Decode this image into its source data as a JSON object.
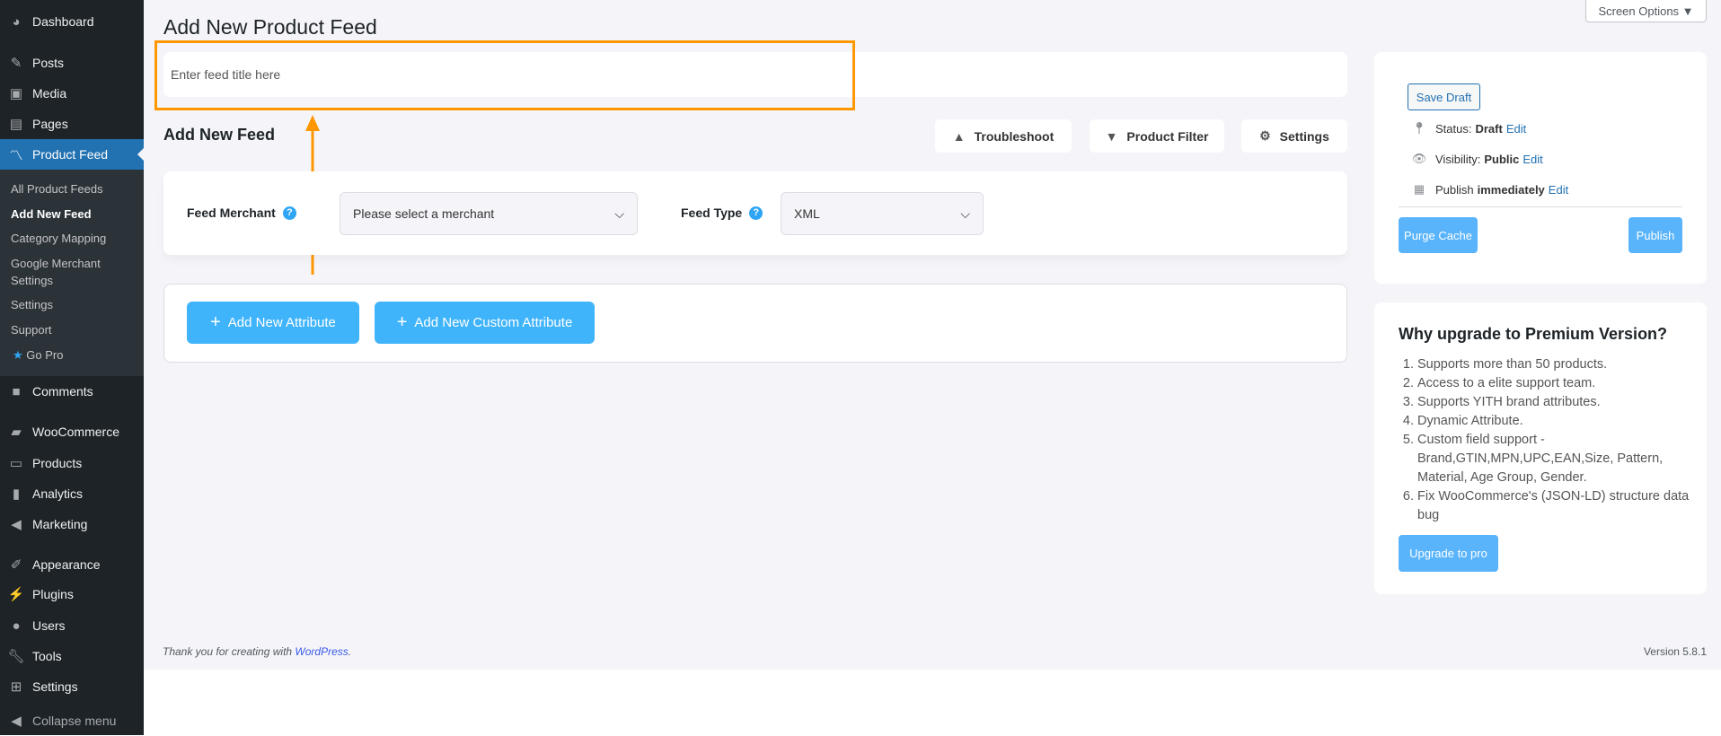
{
  "sidebar": {
    "items": [
      {
        "label": "Dashboard",
        "icon": "dashboard-icon"
      },
      {
        "label": "Posts",
        "icon": "pin-icon"
      },
      {
        "label": "Media",
        "icon": "media-icon"
      },
      {
        "label": "Pages",
        "icon": "pages-icon"
      },
      {
        "label": "Product Feed",
        "icon": "product-feed-icon"
      },
      {
        "label": "Comments",
        "icon": "comments-icon"
      },
      {
        "label": "WooCommerce",
        "icon": "woocommerce-icon"
      },
      {
        "label": "Products",
        "icon": "products-icon"
      },
      {
        "label": "Analytics",
        "icon": "analytics-icon"
      },
      {
        "label": "Marketing",
        "icon": "megaphone-icon"
      },
      {
        "label": "Appearance",
        "icon": "brush-icon"
      },
      {
        "label": "Plugins",
        "icon": "plugin-icon"
      },
      {
        "label": "Users",
        "icon": "user-icon"
      },
      {
        "label": "Tools",
        "icon": "wrench-icon"
      },
      {
        "label": "Settings",
        "icon": "settings-icon"
      },
      {
        "label": "Collapse menu",
        "icon": "collapse-icon"
      }
    ],
    "submenu": [
      "All Product Feeds",
      "Add New Feed",
      "Category Mapping",
      "Google Merchant Settings",
      "Settings",
      "Support",
      "Go Pro"
    ]
  },
  "header": {
    "title": "Add New Product Feed",
    "screen_options": "Screen Options ▼"
  },
  "feed_title": {
    "placeholder": "Enter feed title here"
  },
  "section": {
    "title": "Add New Feed",
    "troubleshoot": "Troubleshoot",
    "product_filter": "Product Filter",
    "settings": "Settings"
  },
  "form": {
    "merchant_label": "Feed Merchant",
    "merchant_value": "Please select a merchant",
    "type_label": "Feed Type",
    "type_value": "XML"
  },
  "attributes": {
    "add": "Add New Attribute",
    "add_custom": "Add New Custom Attribute"
  },
  "publish": {
    "save_draft": "Save Draft",
    "status_label": "Status:",
    "status_value": "Draft",
    "visibility_label": "Visibility:",
    "visibility_value": "Public",
    "publish_label": "Publish",
    "publish_value": "immediately",
    "edit": "Edit",
    "purge": "Purge Cache",
    "publish_btn": "Publish"
  },
  "premium": {
    "title": "Why upgrade to Premium Version?",
    "items": [
      "Supports more than 50 products.",
      "Access to a elite support team.",
      "Supports YITH brand attributes.",
      "Dynamic Attribute.",
      "Custom field support - Brand,GTIN,MPN,UPC,EAN,Size, Pattern, Material, Age Group, Gender.",
      "Fix WooCommerce's (JSON-LD) structure data bug"
    ],
    "button": "Upgrade to pro"
  },
  "footer": {
    "thanks": "Thank you for creating with ",
    "wp": "WordPress",
    "dot": ".",
    "version": "Version 5.8.1"
  },
  "colors": {
    "accent": "#40b4fb",
    "annotation": "#ff9800",
    "sidebar": "#1d2327",
    "active": "#2271b1"
  }
}
